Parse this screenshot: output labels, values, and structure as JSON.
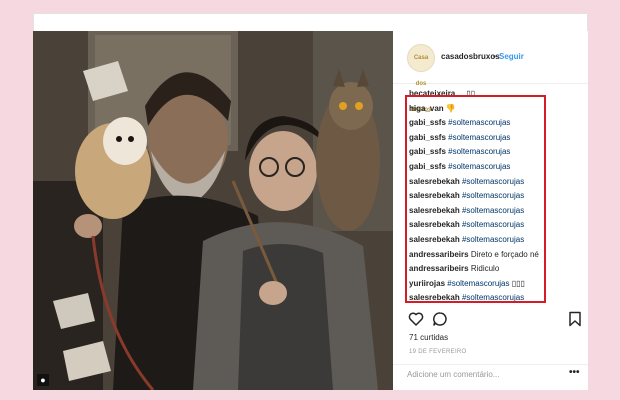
{
  "post": {
    "username": "casadosbruxos",
    "separator": "•",
    "follow_label": "Seguir",
    "avatar_text": "Casa dos Bruxos"
  },
  "comments": [
    {
      "user": "becateixeira__",
      "text": "▯▯",
      "tag": "",
      "after": ""
    },
    {
      "user": "higa_van",
      "text": "👎",
      "tag": "",
      "after": ""
    },
    {
      "user": "gabi_ssfs",
      "text": "",
      "tag": "#soltemascorujas",
      "after": ""
    },
    {
      "user": "gabi_ssfs",
      "text": "",
      "tag": "#soltemascorujas",
      "after": ""
    },
    {
      "user": "gabi_ssfs",
      "text": "",
      "tag": "#soltemascorujas",
      "after": ""
    },
    {
      "user": "gabi_ssfs",
      "text": "",
      "tag": "#soltemascorujas",
      "after": ""
    },
    {
      "user": "salesrebekah",
      "text": "",
      "tag": "#soltemascorujas",
      "after": ""
    },
    {
      "user": "salesrebekah",
      "text": "",
      "tag": "#soltemascorujas",
      "after": ""
    },
    {
      "user": "salesrebekah",
      "text": "",
      "tag": "#soltemascorujas",
      "after": ""
    },
    {
      "user": "salesrebekah",
      "text": "",
      "tag": "#soltemascorujas",
      "after": ""
    },
    {
      "user": "salesrebekah",
      "text": "",
      "tag": "#soltemascorujas",
      "after": ""
    },
    {
      "user": "andressaribeirs",
      "text": "Direto e forçado né",
      "tag": "",
      "after": ""
    },
    {
      "user": "andressaribeirs",
      "text": "Ridiculo",
      "tag": "",
      "after": ""
    },
    {
      "user": "yuriirojas",
      "text": "",
      "tag": "#soltemascorujas",
      "after": "▯▯▯"
    },
    {
      "user": "salesrebekah",
      "text": "",
      "tag": "#soltemascorujas",
      "after": ""
    }
  ],
  "likes_text": "71 curtidas",
  "date_text": "19 DE FEVEREIRO",
  "add_comment_placeholder": "Adicione um comentário...",
  "more_options": "•••",
  "colors": {
    "background": "#f6d9e0",
    "highlight": "#d31e2a",
    "link": "#3897f0",
    "hashtag": "#003569"
  },
  "icons": {
    "like": "heart-icon",
    "comment": "comment-bubble-icon",
    "save": "bookmark-icon",
    "photo_badge": "user-tag-icon"
  }
}
